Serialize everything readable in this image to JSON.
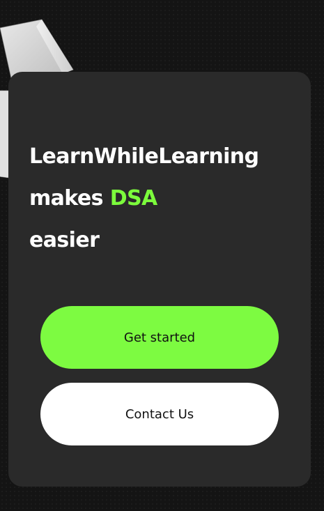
{
  "hero": {
    "headline_line1": "LearnWhileLearning",
    "headline_line2_prefix": "makes",
    "headline_line2_accent": "DSA",
    "headline_line3": "easier"
  },
  "actions": {
    "primary_label": "Get started",
    "secondary_label": "Contact Us"
  },
  "colors": {
    "page_background": "#141414",
    "card_background": "#2a2a2a",
    "accent_green": "#7cfc3c",
    "primary_button": "#7dfb41",
    "secondary_button": "#ffffff",
    "text_light": "#ffffff",
    "text_dark": "#111111"
  }
}
